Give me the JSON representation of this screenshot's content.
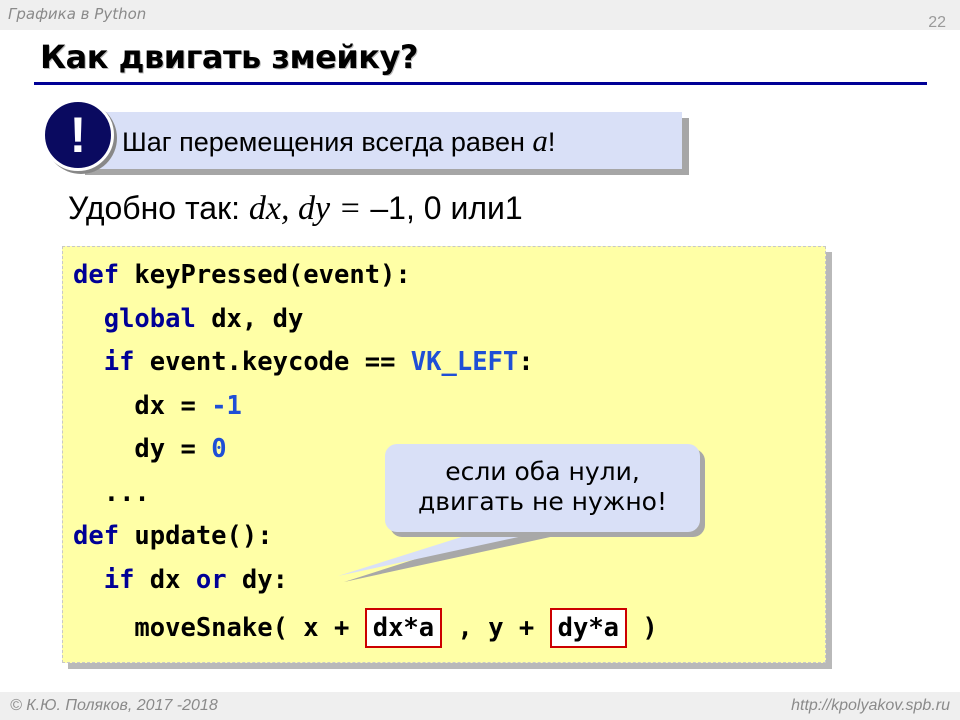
{
  "header": {
    "course": "Графика в Python",
    "page_number": "22"
  },
  "title": "Как двигать змейку?",
  "note": {
    "icon": "!",
    "text_before": "Шаг перемещения всегда равен ",
    "text_var": "a",
    "text_after": "!"
  },
  "subline": {
    "prefix": "Удобно так: ",
    "vars": "dx, dy =",
    "values": " –1, 0 или1"
  },
  "code": {
    "l1_kw": "def",
    "l1_rest": " keyPressed(event):",
    "l2_kw": "global",
    "l2_rest": " dx, dy",
    "l3_kw": "if",
    "l3_mid": " event.keycode == ",
    "l3_const": "VK_LEFT",
    "l3_end": ":",
    "l4_a": "dx = ",
    "l4_b": "-1",
    "l5_a": "dy = ",
    "l5_b": "0",
    "l6": "...",
    "l7_kw": "def",
    "l7_rest": " update():",
    "l8_kw": "if",
    "l8_mid": " dx ",
    "l8_or": "or",
    "l8_end": " dy:",
    "l9_a": "moveSnake( x + ",
    "l9_box1": "dx*a",
    "l9_b": " , y + ",
    "l9_box2": "dy*a",
    "l9_c": " )"
  },
  "bubble": {
    "line1": "если оба нули,",
    "line2": "двигать не нужно!"
  },
  "footer": {
    "left": "© К.Ю. Поляков, 2017 -2018",
    "right": "http://kpolyakov.spb.ru"
  }
}
